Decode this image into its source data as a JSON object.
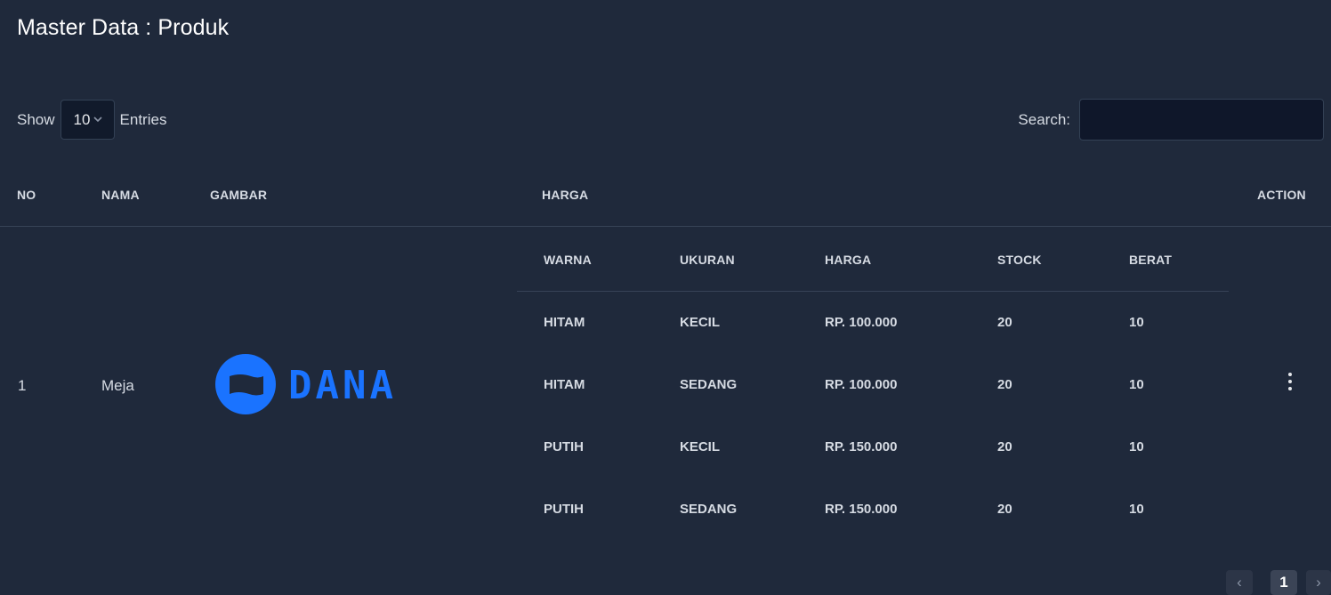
{
  "page": {
    "title": "Master Data : Produk"
  },
  "controls": {
    "show_label": "Show",
    "entries_value": "10",
    "entries_label": "Entries",
    "search_label": "Search:",
    "search_value": ""
  },
  "table": {
    "headers": {
      "no": "NO",
      "nama": "NAMA",
      "gambar": "GAMBAR",
      "harga": "HARGA",
      "action": "ACTION"
    },
    "rows": [
      {
        "no": "1",
        "nama": "Meja",
        "logo_text": "DANA",
        "logo_color": "#1a73ff",
        "variants_headers": {
          "warna": "WARNA",
          "ukuran": "UKURAN",
          "harga": "HARGA",
          "stock": "STOCK",
          "berat": "BERAT"
        },
        "variants": [
          {
            "warna": "HITAM",
            "ukuran": "KECIL",
            "harga": "RP. 100.000",
            "stock": "20",
            "berat": "10"
          },
          {
            "warna": "HITAM",
            "ukuran": "SEDANG",
            "harga": "RP. 100.000",
            "stock": "20",
            "berat": "10"
          },
          {
            "warna": "PUTIH",
            "ukuran": "KECIL",
            "harga": "RP. 150.000",
            "stock": "20",
            "berat": "10"
          },
          {
            "warna": "PUTIH",
            "ukuran": "SEDANG",
            "harga": "RP. 150.000",
            "stock": "20",
            "berat": "10"
          }
        ],
        "action_icon": "more-vertical-icon"
      }
    ]
  },
  "pagination": {
    "prev": "‹",
    "current": "1",
    "next": "›"
  },
  "colors": {
    "background": "#1f293b",
    "input_bg": "#0f172a",
    "divider": "#374357",
    "accent_logo": "#1a73ff"
  }
}
